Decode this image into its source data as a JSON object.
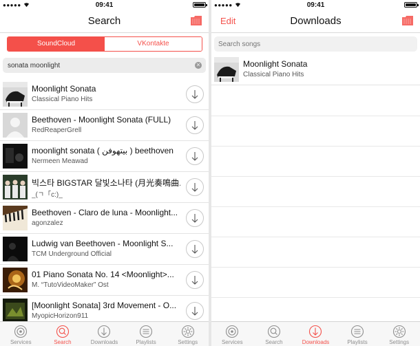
{
  "colors": {
    "accent": "#f4504a",
    "separator": "#e3e3e3",
    "inactive_tab": "#8e8e8e"
  },
  "left": {
    "status": {
      "signal": "●●●●●",
      "time": "09:41"
    },
    "title": "Search",
    "segments": [
      "SoundCloud",
      "VKontakte"
    ],
    "selected_segment": "SoundCloud",
    "search_value": "sonata moonlight",
    "results": [
      {
        "title": "Moonlight Sonata",
        "subtitle": "Classical Piano Hits",
        "art": "piano-album-art"
      },
      {
        "title": "Beethoven - Moonlight Sonata (FULL)",
        "subtitle": "RedReaperGrell",
        "art": "default-avatar"
      },
      {
        "title": "moonlight sonata ( بيتهوفن ) beethoven",
        "subtitle": "Nermeen Meawad",
        "art": "dark-art"
      },
      {
        "title": "빅스타 BIGSTAR 달빛소나타 (月光奏鳴曲...",
        "subtitle": "_(ㄱ「c:)_",
        "art": "group-photo-art"
      },
      {
        "title": "Beethoven - Claro de luna - Moonlight...",
        "subtitle": "agonzalez",
        "art": "piano-keys-art"
      },
      {
        "title": "Ludwig van Beethoven - Moonlight S...",
        "subtitle": "TCM Underground Official",
        "art": "dark-figure-art"
      },
      {
        "title": "01 Piano Sonata No. 14 <Moonlight>...",
        "subtitle": "M. “TutoVideoMaker” Ost",
        "art": "golden-art"
      },
      {
        "title": "[Moonlight Sonata] 3rd Movement - O...",
        "subtitle": "MyopicHorizon911",
        "art": "green-art"
      }
    ],
    "active_tab": "Search"
  },
  "right": {
    "status": {
      "signal": "●●●●●",
      "time": "09:41"
    },
    "title": "Downloads",
    "edit_label": "Edit",
    "search_placeholder": "Search songs",
    "downloads": [
      {
        "title": "Moonlight Sonata",
        "subtitle": "Classical Piano Hits",
        "art": "piano-album-art"
      }
    ],
    "active_tab": "Downloads"
  },
  "tabs": [
    {
      "label": "Services",
      "icon": "services-icon"
    },
    {
      "label": "Search",
      "icon": "search-icon"
    },
    {
      "label": "Downloads",
      "icon": "download-icon"
    },
    {
      "label": "Playlists",
      "icon": "playlists-icon"
    },
    {
      "label": "Settings",
      "icon": "settings-icon"
    }
  ]
}
